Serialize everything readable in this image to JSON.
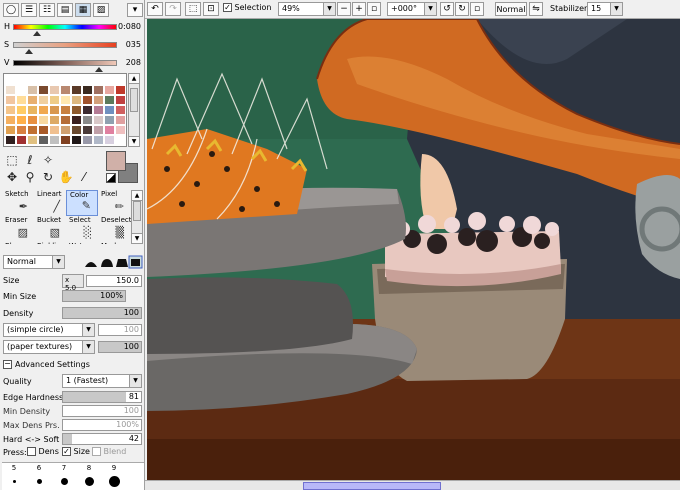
{
  "color_panel": {
    "h_label": "H",
    "h_value": "0:080",
    "s_label": "S",
    "s_value": "035",
    "v_label": "V",
    "v_value": "208",
    "h_level": 0.22,
    "s_level": 0.14,
    "v_level": 0.82
  },
  "swatches": [
    "#ffffff",
    "#ffffff",
    "#ffffff",
    "#ffffff",
    "#ffffff",
    "#ffffff",
    "#ffffff",
    "#ffffff",
    "#ffffff",
    "#ffffff",
    "#ffffff",
    "#f0e0d0",
    "#fff",
    "#d8c0a8",
    "#7a4a2e",
    "#e8c8b0",
    "#b88870",
    "#5a3a28",
    "#3a2a20",
    "#a07060",
    "#e8a8a0",
    "#c0392b",
    "#f2c6a0",
    "#ffdd99",
    "#e8b070",
    "#f0d0a0",
    "#eecc88",
    "#ffe8b0",
    "#ddb880",
    "#a0522d",
    "#d2a07a",
    "#5c7a5c",
    "#c04040",
    "#f5c58a",
    "#ffcc66",
    "#e8b560",
    "#f0a850",
    "#d89850",
    "#c88040",
    "#8e5a2e",
    "#3c2a30",
    "#b47b94",
    "#7090c0",
    "#d06060",
    "#f5b060",
    "#ffb04a",
    "#e89040",
    "#f8d8a0",
    "#ddaa66",
    "#b56d38",
    "#3a2020",
    "#8a8a8a",
    "#d8c8c8",
    "#90a0b0",
    "#e0a0a0",
    "#e0a050",
    "#d88040",
    "#c07030",
    "#a85a28",
    "#f0c090",
    "#d0a070",
    "#6a4a30",
    "#4a3a38",
    "#c0a0a8",
    "#e080a0",
    "#f0c0c0",
    "#302020",
    "#a03030",
    "#e0c080",
    "#606060",
    "#c0c0c0",
    "#804020",
    "#201818",
    "#9898a8",
    "#b0b8c8",
    "#d8d0e0",
    "#ffffff"
  ],
  "brush_tools": [
    {
      "label": "Sketch",
      "icon": "✒"
    },
    {
      "label": "Lineart",
      "icon": "╱"
    },
    {
      "label": "Color",
      "icon": "✎"
    },
    {
      "label": "Pixel",
      "icon": "✏"
    },
    {
      "label": "Eraser",
      "icon": "▨"
    },
    {
      "label": "Bucket",
      "icon": "▧"
    },
    {
      "label": "Select",
      "icon": "░"
    },
    {
      "label": "Deselect",
      "icon": "▒"
    },
    {
      "label": "Blur",
      "icon": ""
    },
    {
      "label": "Binkli",
      "icon": ""
    },
    {
      "label": "Water",
      "icon": ""
    },
    {
      "label": "Marker",
      "icon": ""
    }
  ],
  "brush": {
    "blend_mode": "Normal",
    "size_label": "Size",
    "size_multiplier": "x 5.0",
    "size_value": "150.0",
    "min_size_label": "Min Size",
    "min_size_value": "100%",
    "min_size_level": 1.0,
    "density_label": "Density",
    "density_value": "100",
    "density_level": 1.0,
    "shape": "(simple circle)",
    "shape_value": "100",
    "texture": "(paper textures)",
    "texture_value": "100",
    "advanced_label": "Advanced Settings",
    "quality_label": "Quality",
    "quality_value": "1 (Fastest)",
    "edge_hardness_label": "Edge Hardness",
    "edge_hardness_value": "81",
    "edge_hardness_level": 0.81,
    "min_density_label": "Min Density",
    "min_density_value": "100",
    "max_dens_label": "Max Dens Prs.",
    "max_dens_value": "100%",
    "hard_soft_label": "Hard <-> Soft",
    "hard_soft_value": "42",
    "hard_soft_level": 0.12,
    "press_label": "Press:",
    "press_dens": "Dens",
    "press_size": "Size",
    "press_blend": "Blend"
  },
  "brush_sizes": [
    "5",
    "6",
    "7",
    "8",
    "9"
  ],
  "toolbar": {
    "selection_label": "Selection",
    "zoom": "49%",
    "rotation": "+000°",
    "blend": "Normal",
    "stabilizer_label": "Stabilizer",
    "stabilizer_value": "15"
  }
}
